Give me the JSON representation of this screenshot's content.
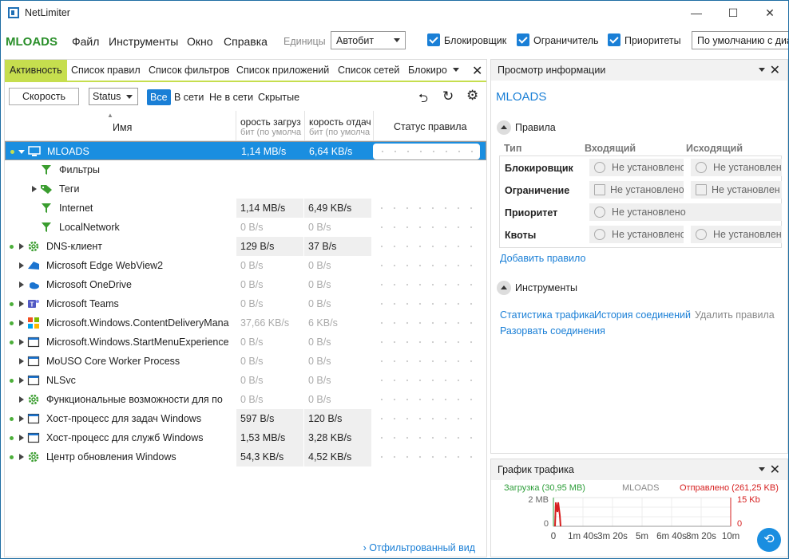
{
  "window": {
    "title": "NetLimiter",
    "minimize": "—",
    "maximize": "☐",
    "close": "✕"
  },
  "menubar": {
    "brand": "MLOADS",
    "menus": [
      "Файл",
      "Инструменты",
      "Окно",
      "Справка"
    ],
    "units_label": "Единицы",
    "units_value": "Автобит",
    "checks": [
      "Блокировщик",
      "Ограничитель",
      "Приоритеты"
    ],
    "profile_value": "По умолчанию с диа"
  },
  "tabs": [
    "Активность",
    "Список правил",
    "Список фильтров",
    "Список приложений",
    "Список сетей",
    "Блокиро"
  ],
  "filters": {
    "speed_button": "Скорость",
    "status_select": "Status",
    "pills": [
      "Все",
      "В сети",
      "Не в сети",
      "Скрытые"
    ]
  },
  "columns": {
    "name": "Имя",
    "download": "орость загруз",
    "download_sub": "бит (по умолча",
    "upload": "корость отдач",
    "upload_sub": "бит (по умолча",
    "status": "Статус правила"
  },
  "rows": [
    {
      "name": "MLOADS",
      "dl": "1,14 MB/s",
      "ul": "6,64 KB/s"
    },
    {
      "name": "Фильтры",
      "dl": "",
      "ul": ""
    },
    {
      "name": "Теги",
      "dl": "",
      "ul": ""
    },
    {
      "name": "Internet",
      "dl": "1,14 MB/s",
      "ul": "6,49 KB/s"
    },
    {
      "name": "LocalNetwork",
      "dl": "0 B/s",
      "ul": "0 B/s"
    },
    {
      "name": "DNS-клиент",
      "dl": "129 B/s",
      "ul": "37 B/s"
    },
    {
      "name": "Microsoft Edge WebView2",
      "dl": "0 B/s",
      "ul": "0 B/s"
    },
    {
      "name": "Microsoft OneDrive",
      "dl": "0 B/s",
      "ul": "0 B/s"
    },
    {
      "name": "Microsoft Teams",
      "dl": "0 B/s",
      "ul": "0 B/s"
    },
    {
      "name": "Microsoft.Windows.ContentDeliveryMana",
      "dl": "37,66 KB/s",
      "ul": "6 KB/s"
    },
    {
      "name": "Microsoft.Windows.StartMenuExperience",
      "dl": "0 B/s",
      "ul": "0 B/s"
    },
    {
      "name": "MoUSO Core Worker Process",
      "dl": "0 B/s",
      "ul": "0 B/s"
    },
    {
      "name": "NLSvc",
      "dl": "0 B/s",
      "ul": "0 B/s"
    },
    {
      "name": "Функциональные возможности для по",
      "dl": "0 B/s",
      "ul": "0 B/s"
    },
    {
      "name": "Хост-процесс для задач Windows",
      "dl": "597 B/s",
      "ul": "120 B/s"
    },
    {
      "name": "Хост-процесс для служб Windows",
      "dl": "1,53 MB/s",
      "ul": "3,28 KB/s"
    },
    {
      "name": "Центр обновления Windows",
      "dl": "54,3 KB/s",
      "ul": "4,52 KB/s"
    }
  ],
  "bottom_link": "Отфильтрованный вид",
  "info_panel": {
    "title": "Просмотр информации",
    "subject": "MLOADS",
    "rules_section": "Правила",
    "col_type": "Тип",
    "col_in": "Входящий",
    "col_out": "Исходящий",
    "rules": [
      {
        "type": "Блокировщик",
        "in": "Не установлено",
        "out": "Не установлен"
      },
      {
        "type": "Ограничение",
        "in": "Не установлено",
        "out": "Не установлен"
      },
      {
        "type": "Приоритет",
        "in": "Не установлено",
        "out": ""
      },
      {
        "type": "Квоты",
        "in": "Не установлено",
        "out": "Не установлен"
      }
    ],
    "add_rule": "Добавить правило",
    "tools_section": "Инструменты",
    "tool_links": [
      "Статистика трафика",
      "История соединений",
      "Удалить правила",
      "Разорвать соединения"
    ]
  },
  "traffic_panel": {
    "title": "График трафика",
    "download_label": "Загрузка (30,95 MB)",
    "center_label": "MLOADS",
    "upload_label": "Отправлено (261,25 KB)",
    "y_left_top": "2 MB",
    "y_right_top": "15 Kb",
    "y_left_zero": "0",
    "y_right_zero": "0",
    "x_ticks": [
      "0",
      "1m 40s",
      "3m 20s",
      "5m",
      "6m 40s",
      "8m 20s",
      "10m"
    ],
    "colors": {
      "download": "#2e9e3a",
      "upload": "#d61f1f"
    }
  }
}
